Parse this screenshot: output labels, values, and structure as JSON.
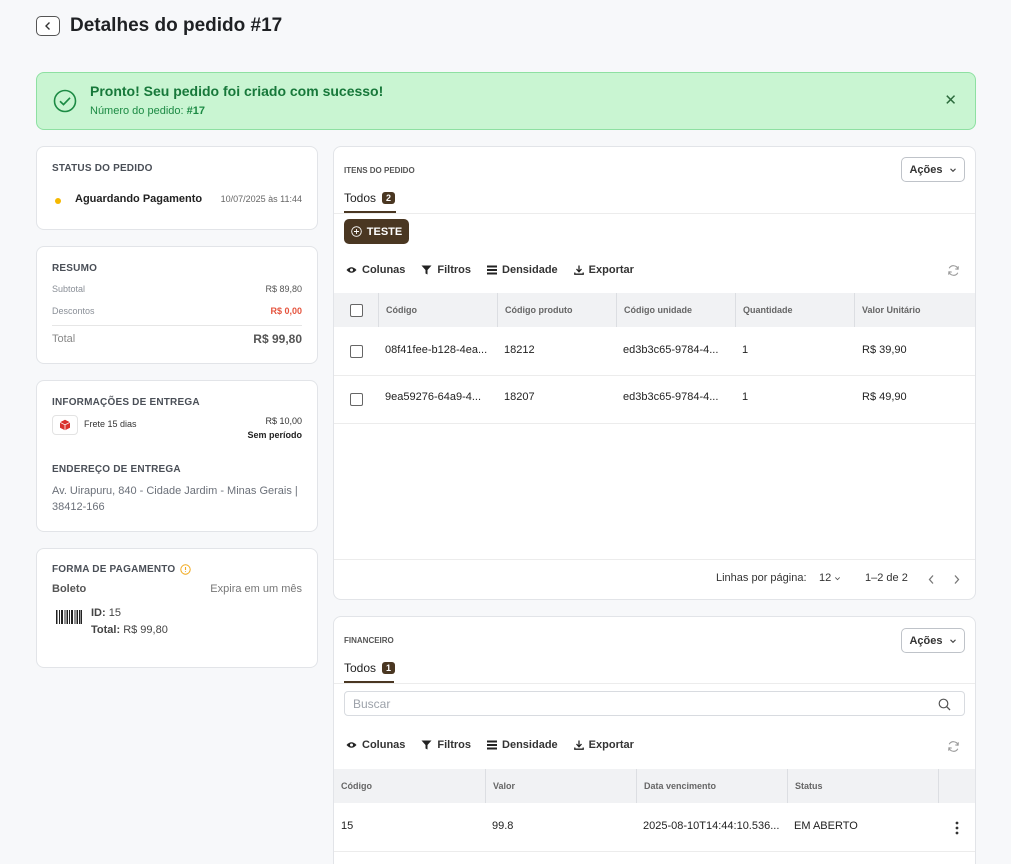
{
  "header": {
    "title": "Detalhes do pedido #17"
  },
  "alert": {
    "title": "Pronto! Seu pedido foi criado com sucesso!",
    "order_label": "Número do pedido:",
    "order_value": "#17",
    "close_glyph": "✕"
  },
  "status_card": {
    "heading": "STATUS DO PEDIDO",
    "status": "Aguardando Pagamento",
    "datetime": "10/07/2025 às 11:44",
    "dot_color": "#f5b800"
  },
  "summary": {
    "heading": "RESUMO",
    "subtotal_label": "Subtotal",
    "subtotal_value": "R$ 89,80",
    "discount_label": "Descontos",
    "discount_value": "R$ 0,00",
    "total_label": "Total",
    "total_value": "R$ 99,80",
    "discount_color": "#e5533d"
  },
  "delivery": {
    "heading": "INFORMAÇÕES DE ENTREGA",
    "method": "Frete 15 dias",
    "price": "R$ 10,00",
    "period": "Sem período",
    "address_heading": "ENDEREÇO DE ENTREGA",
    "address_line1": "Av. Uirapuru, 840 - Cidade Jardim - Minas Gerais |",
    "address_line2": "38412-166"
  },
  "payment": {
    "heading": "FORMA DE PAGAMENTO",
    "method": "Boleto",
    "expires": "Expira em um mês",
    "id_label": "ID:",
    "id_value": "15",
    "total_label": "Total:",
    "total_value": "R$ 99,80"
  },
  "items": {
    "heading": "ITENS DO PEDIDO",
    "actions_label": "Ações",
    "tab_label": "Todos",
    "tab_count": "2",
    "teste_button": "TESTE",
    "toolbar": {
      "columns": "Colunas",
      "filters": "Filtros",
      "density": "Densidade",
      "export": "Exportar"
    },
    "columns": [
      "Código",
      "Código produto",
      "Código unidade",
      "Quantidade",
      "Valor Unitário"
    ],
    "rows": [
      [
        "08f41fee-b128-4ea...",
        "18212",
        "ed3b3c65-9784-4...",
        "1",
        "R$ 39,90"
      ],
      [
        "9ea59276-64a9-4...",
        "18207",
        "ed3b3c65-9784-4...",
        "1",
        "R$ 49,90"
      ]
    ],
    "pagination": {
      "rows_per_page_label": "Linhas por página:",
      "rows_per_page": "12",
      "range": "1–2 de 2"
    }
  },
  "financial": {
    "heading": "FINANCEIRO",
    "actions_label": "Ações",
    "tab_label": "Todos",
    "tab_count": "1",
    "search_placeholder": "Buscar",
    "toolbar": {
      "columns": "Colunas",
      "filters": "Filtros",
      "density": "Densidade",
      "export": "Exportar"
    },
    "columns": [
      "Código",
      "Valor",
      "Data vencimento",
      "Status"
    ],
    "rows": [
      [
        "15",
        "99.8",
        "2025-08-10T14:44:10.536...",
        "EM ABERTO"
      ]
    ]
  }
}
